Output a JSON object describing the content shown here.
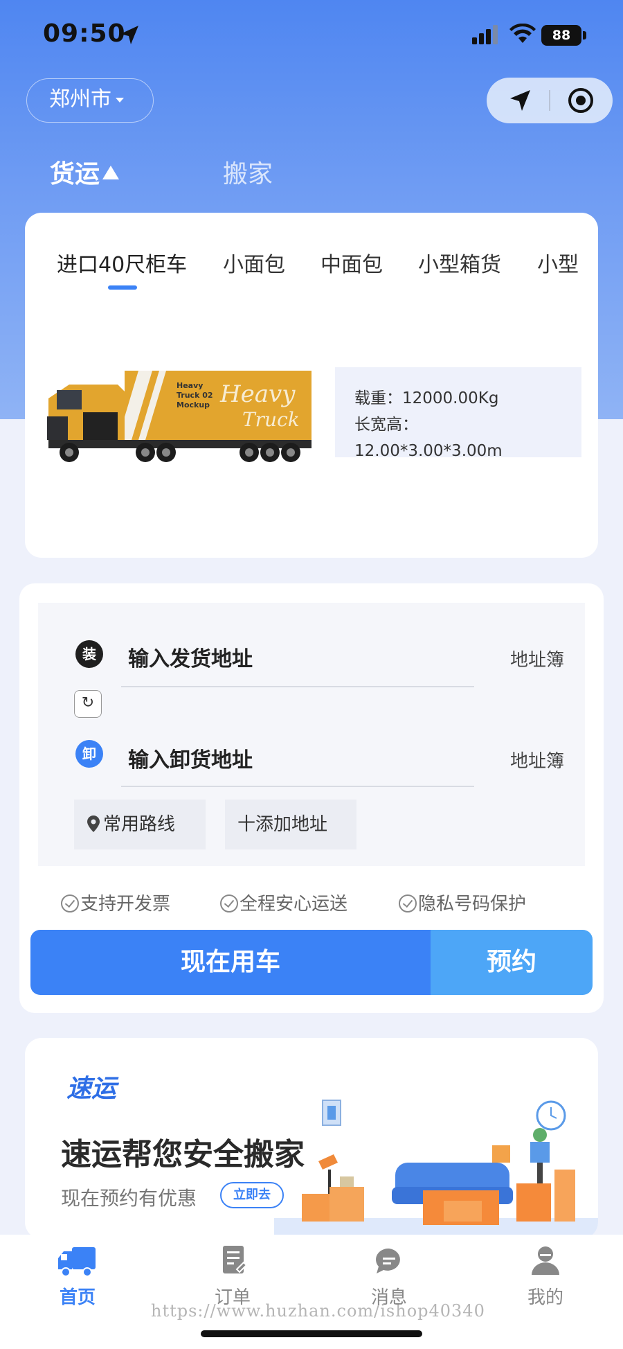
{
  "status_bar": {
    "time": "09:50",
    "battery": "88"
  },
  "header": {
    "city": "郑州市"
  },
  "mode_tabs": [
    {
      "label": "货运",
      "active": true
    },
    {
      "label": "搬家",
      "active": false
    }
  ],
  "vehicle": {
    "tabs": [
      "进口40尺柜车",
      "小面包",
      "中面包",
      "小型箱货",
      "小型"
    ],
    "active_index": 0,
    "image_text": "Heavy Truck 02 Mockup",
    "specs": {
      "load": "载重：12000.00Kg",
      "dimensions": "长宽高：12.00*3.00*3.00m"
    }
  },
  "address": {
    "load_badge": "装",
    "unload_badge": "卸",
    "from_placeholder": "输入发货地址",
    "to_placeholder": "输入卸货地址",
    "address_book": "地址簿",
    "routes_label": "常用路线",
    "add_label": "十添加地址",
    "swap_icon": "↻"
  },
  "features": [
    "支持开发票",
    "全程安心运送",
    "隐私号码保护"
  ],
  "actions": {
    "now": "现在用车",
    "book": "预约"
  },
  "promo": {
    "brand": "速运",
    "title": "速运帮您安全搬家",
    "subtitle": "现在预约有优惠",
    "button": "立即去"
  },
  "nav": [
    {
      "label": "首页",
      "icon": "truck-icon",
      "active": true
    },
    {
      "label": "订单",
      "icon": "order-icon",
      "active": false
    },
    {
      "label": "消息",
      "icon": "message-icon",
      "active": false
    },
    {
      "label": "我的",
      "icon": "user-icon",
      "active": false
    }
  ],
  "watermark": "https://www.huzhan.com/ishop40340",
  "colors": {
    "primary": "#3b82f6",
    "secondary": "#4da6f7",
    "hero": "#4f86f1"
  }
}
